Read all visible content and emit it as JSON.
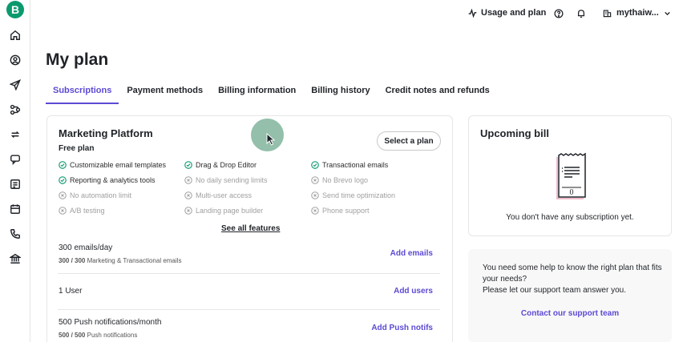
{
  "sidebar": {
    "logo_letter": "B",
    "items": [
      {
        "icon": "home-icon"
      },
      {
        "icon": "contacts-icon"
      },
      {
        "icon": "campaigns-icon"
      },
      {
        "icon": "automations-icon"
      },
      {
        "icon": "conversations-icon"
      },
      {
        "icon": "transactional-icon"
      },
      {
        "icon": "forms-icon"
      },
      {
        "icon": "calendar-icon"
      },
      {
        "icon": "phone-icon"
      },
      {
        "icon": "bank-icon"
      }
    ]
  },
  "topbar": {
    "usage_label": "Usage and plan",
    "account_name": "mythaiw..."
  },
  "page": {
    "title": "My plan",
    "tabs": [
      {
        "label": "Subscriptions",
        "active": true
      },
      {
        "label": "Payment methods",
        "active": false
      },
      {
        "label": "Billing information",
        "active": false
      },
      {
        "label": "Billing history",
        "active": false
      },
      {
        "label": "Credit notes and refunds",
        "active": false
      }
    ]
  },
  "plan": {
    "title": "Marketing Platform",
    "subtitle": "Free plan",
    "select_button": "Select a plan",
    "features": [
      {
        "label": "Customizable email templates",
        "included": true
      },
      {
        "label": "Drag & Drop Editor",
        "included": true
      },
      {
        "label": "Transactional emails",
        "included": true
      },
      {
        "label": "Reporting & analytics tools",
        "included": true
      },
      {
        "label": "No daily sending limits",
        "included": false
      },
      {
        "label": "No Brevo logo",
        "included": false
      },
      {
        "label": "No automation limit",
        "included": false
      },
      {
        "label": "Multi-user access",
        "included": false
      },
      {
        "label": "Send time optimization",
        "included": false
      },
      {
        "label": "A/B testing",
        "included": false
      },
      {
        "label": "Landing page builder",
        "included": false
      },
      {
        "label": "Phone support",
        "included": false
      }
    ],
    "see_all": "See all features",
    "rows": [
      {
        "title": "300 emails/day",
        "usage": "300 / 300",
        "usage_desc": "Marketing & Transactional emails",
        "action": "Add emails"
      },
      {
        "title": "1 User",
        "usage": "",
        "usage_desc": "",
        "action": "Add users"
      },
      {
        "title": "500 Push notifications/month",
        "usage": "500 / 500",
        "usage_desc": "Push notifications",
        "action": "Add Push notifs"
      }
    ]
  },
  "bill": {
    "title": "Upcoming bill",
    "receipt_value": "0",
    "empty_message": "You don't have any subscription yet."
  },
  "help": {
    "line1": "You need some help to know the right plan that fits your needs?",
    "line2": "Please let our support team answer you.",
    "link": "Contact our support team"
  },
  "colors": {
    "accent": "#5c4ad4",
    "brand": "#0b996e",
    "check": "#0b996e",
    "muted": "#a0a0a0"
  }
}
